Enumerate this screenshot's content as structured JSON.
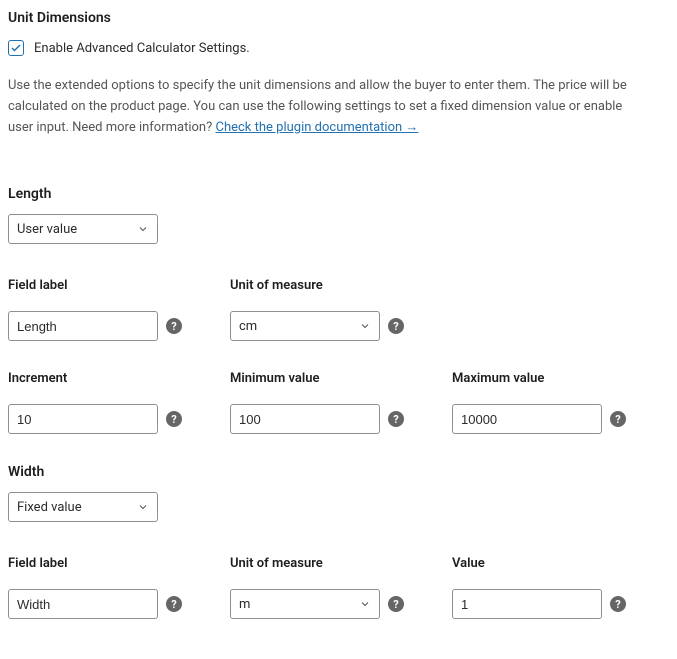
{
  "section_title": "Unit Dimensions",
  "enable_checkbox_label": "Enable Advanced Calculator Settings.",
  "description_pre": "Use the extended options to specify the unit dimensions and allow the buyer to enter them. The price will be calculated on the product page. You can use the following settings to set a fixed dimension value or enable user input. Need more information? ",
  "doc_link_text": "Check the plugin documentation →",
  "length": {
    "title": "Length",
    "type_value": "User value",
    "field_label_label": "Field label",
    "field_label_value": "Length",
    "unit_label": "Unit of measure",
    "unit_value": "cm",
    "increment_label": "Increment",
    "increment_value": "10",
    "min_label": "Minimum value",
    "min_value": "100",
    "max_label": "Maximum value",
    "max_value": "10000"
  },
  "width": {
    "title": "Width",
    "type_value": "Fixed value",
    "field_label_label": "Field label",
    "field_label_value": "Width",
    "unit_label": "Unit of measure",
    "unit_value": "m",
    "value_label": "Value",
    "value_value": "1"
  }
}
